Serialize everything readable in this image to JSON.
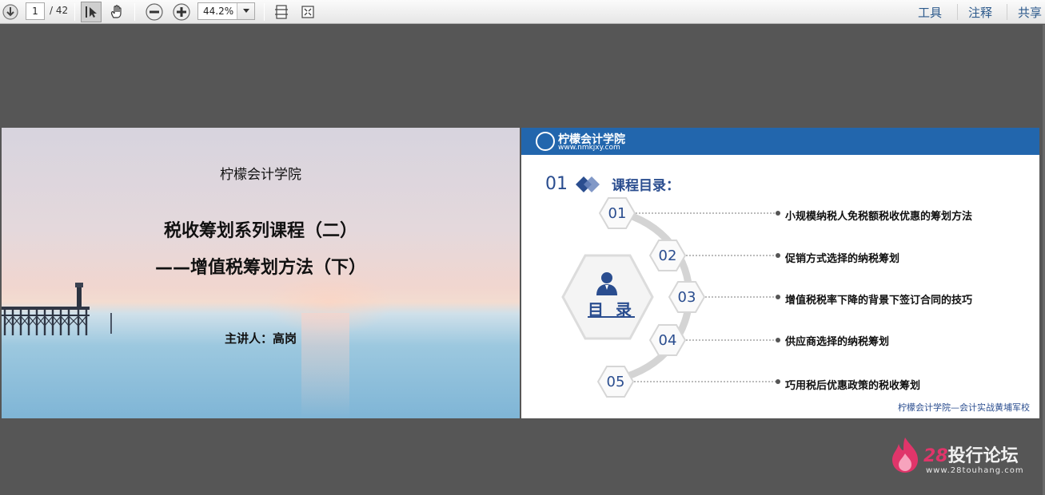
{
  "toolbar": {
    "page_current": "1",
    "page_total": "/ 42",
    "zoom_value": "44.2%",
    "links": [
      "工具",
      "注释",
      "共享"
    ],
    "link_color": "#2d5a8c"
  },
  "slide_left": {
    "org": "柠檬会计学院",
    "title_line1": "税收筹划系列课程（二）",
    "title_line2": "——增值税筹划方法（下）",
    "presenter": "主讲人：高岗"
  },
  "slide_right": {
    "logo_name": "柠檬会计学院",
    "logo_url": "www.nmkjxy.com",
    "section_num": "01",
    "section_title": "课程目录：",
    "center_label": "目 录",
    "items": [
      {
        "num": "01",
        "label": "小规模纳税人免税额税收优惠的筹划方法"
      },
      {
        "num": "02",
        "label": "促销方式选择的纳税筹划"
      },
      {
        "num": "03",
        "label": "增值税税率下降的背景下签订合同的技巧"
      },
      {
        "num": "04",
        "label": "供应商选择的纳税筹划"
      },
      {
        "num": "05",
        "label": "巧用税后优惠政策的税收筹划"
      }
    ],
    "footer": "柠檬会计学院—会计实战黄埔军校",
    "accent_color": "#2266ad"
  },
  "watermark": {
    "num": "28",
    "name": "投行论坛",
    "url": "www.28touhang.com"
  }
}
